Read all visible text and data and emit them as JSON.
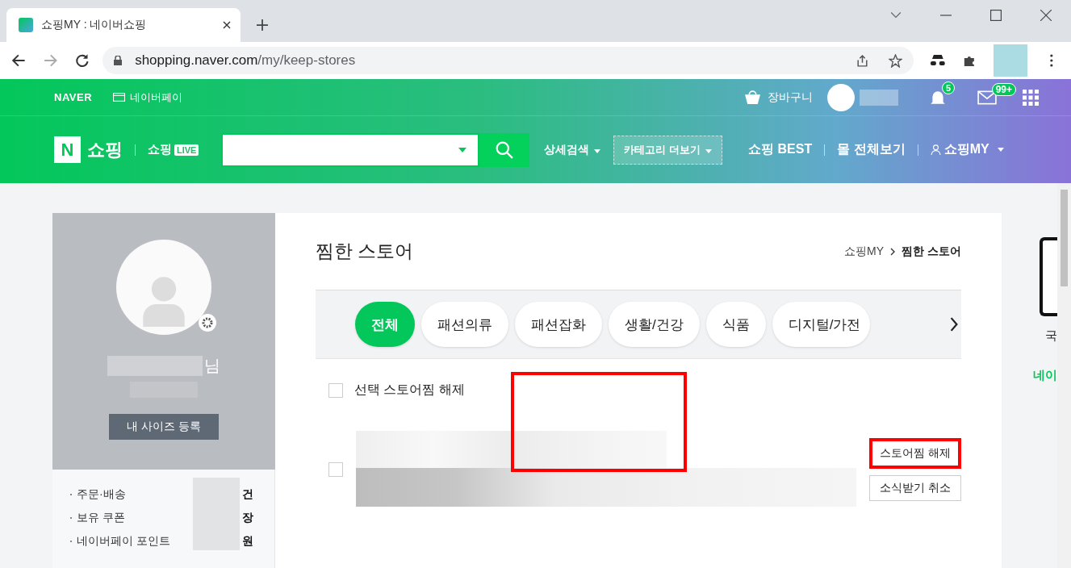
{
  "browser": {
    "tab_title": "쇼핑MY : 네이버쇼핑",
    "url_host": "shopping.naver.com",
    "url_path": "/my/keep-stores"
  },
  "topbar": {
    "logo": "NAVER",
    "pay": "네이버페이",
    "cart": "장바구니",
    "notifications": "5",
    "mail": "99+"
  },
  "header": {
    "logo_mark": "N",
    "logo_text": "쇼핑",
    "live_text": "쇼핑",
    "live_badge": "LIVE",
    "detail_search": "상세검색",
    "category_more": "카테고리 더보기",
    "links": [
      {
        "label": "쇼핑 BEST",
        "kind": "plain"
      },
      {
        "label": "몰 전체보기",
        "kind": "plain"
      },
      {
        "label": "쇼핑MY",
        "kind": "user"
      }
    ]
  },
  "sidebar": {
    "name_suffix": "님",
    "size_button": "내 사이즈 등록",
    "menu": [
      {
        "label": "주문·배송",
        "unit": "건"
      },
      {
        "label": "보유 쿠폰",
        "unit": "장"
      },
      {
        "label": "네이버페이 포인트",
        "unit": "원"
      }
    ]
  },
  "main": {
    "title": "찜한 스토어",
    "breadcrumb": [
      {
        "label": "쇼핑MY",
        "current": false
      },
      {
        "label": "찜한 스토어",
        "current": true
      }
    ],
    "tabs": [
      {
        "label": "전체",
        "selected": true
      },
      {
        "label": "패션의류",
        "selected": false
      },
      {
        "label": "패션잡화",
        "selected": false
      },
      {
        "label": "생활/건강",
        "selected": false
      },
      {
        "label": "식품",
        "selected": false
      },
      {
        "label": "디지털/가전",
        "selected": false
      }
    ],
    "select_all": {
      "label": "선택 스토어찜 해제",
      "checked": false
    },
    "stores": [
      {
        "checked": false,
        "unkeep": "스토어찜 해제",
        "unsubscribe": "소식받기 취소"
      }
    ]
  },
  "aside": {
    "char": "국",
    "link": "네이"
  }
}
